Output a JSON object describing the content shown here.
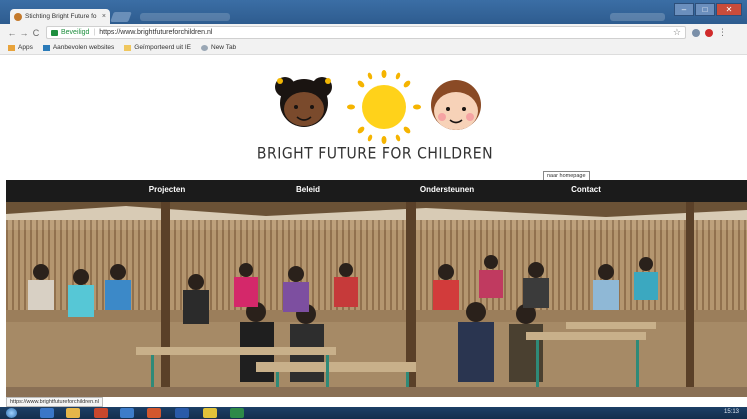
{
  "browser": {
    "tab_title": "Stichting Bright Future fo",
    "tab_close": "×",
    "window_controls": {
      "minimize": "–",
      "maximize": "□",
      "close": "✕"
    },
    "secure_label": "Beveiligd",
    "url": "https://www.brightfutureforchildren.nl",
    "bookmarks": [
      {
        "label": "Apps",
        "icon": "apps-icon"
      },
      {
        "label": "Aanbevolen websites",
        "icon": "web-icon"
      },
      {
        "label": "Geïmporteerd uit IE",
        "icon": "folder-icon"
      },
      {
        "label": "New Tab",
        "icon": "newtab-icon"
      }
    ],
    "status_url": "https://www.brightfutureforchildren.nl"
  },
  "site": {
    "title": "BRIGHT FUTURE FOR CHILDREN",
    "home_tooltip": "naar homepage",
    "nav": [
      {
        "label": "Projecten"
      },
      {
        "label": "Beleid"
      },
      {
        "label": "Ondersteunen"
      },
      {
        "label": "Contact"
      }
    ],
    "hero_image": "classroom-photo"
  },
  "taskbar": {
    "apps": [
      "explorer-icon",
      "folder-icon",
      "powerpoint-icon",
      "outlook-icon",
      "powerpoint-icon",
      "word-icon",
      "chrome-icon",
      "excel-icon"
    ],
    "time": "15:13"
  },
  "colors": {
    "nav_bg": "#1b1b1b",
    "nav_text": "#ffffff",
    "secure_green": "#1e8e3e",
    "sun_yellow": "#ffd21a"
  }
}
